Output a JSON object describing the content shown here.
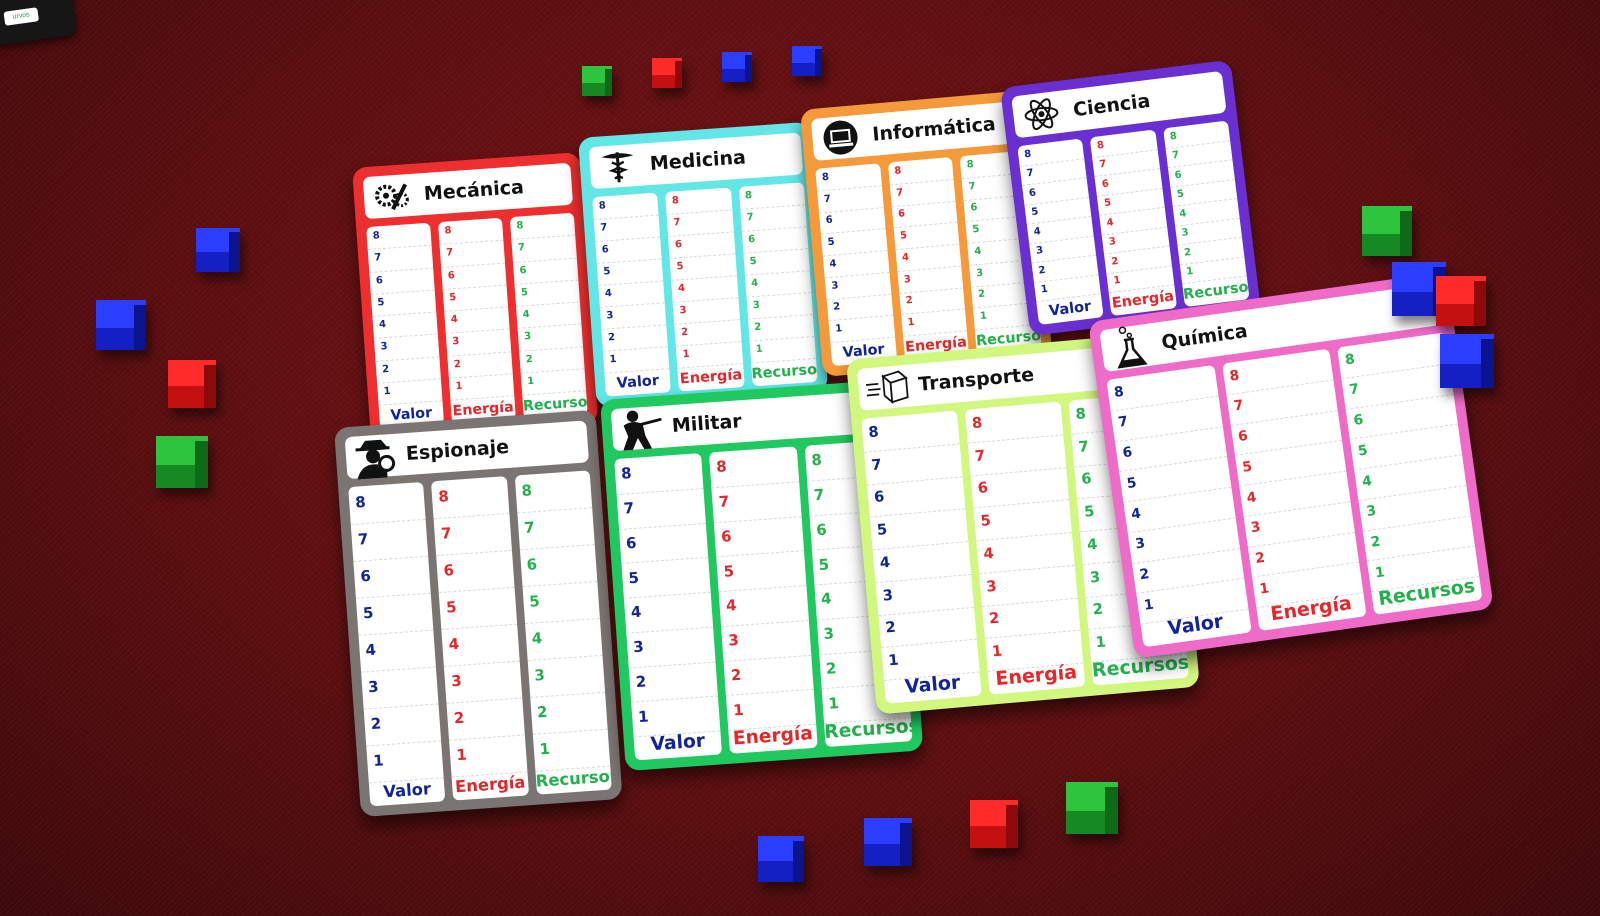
{
  "corner_tab_label": "urvos",
  "column_labels": [
    "Valor",
    "Energía",
    "Recursos"
  ],
  "values": [
    "8",
    "7",
    "6",
    "5",
    "4",
    "3",
    "2",
    "1"
  ],
  "colors": {
    "valor": "#10249a",
    "energia": "#e8262a",
    "recursos": "#22b14c",
    "felt": "#6a1214"
  },
  "cards": [
    {
      "title": "Mecánica",
      "icon": "gears-wrench-icon",
      "color": "#ee2f2f"
    },
    {
      "title": "Medicina",
      "icon": "caduceus-icon",
      "color": "#62e6e6"
    },
    {
      "title": "Informática",
      "icon": "laptop-icon",
      "color": "#f59a3a"
    },
    {
      "title": "Ciencia",
      "icon": "atom-icon",
      "color": "#6a2fd0"
    },
    {
      "title": "Espionaje",
      "icon": "spy-magnifier-icon",
      "color": "#7a7472"
    },
    {
      "title": "Militar",
      "icon": "soldier-icon",
      "color": "#20c860"
    },
    {
      "title": "Transporte",
      "icon": "package-icon",
      "color": "#d2f77e"
    },
    {
      "title": "Química",
      "icon": "flask-icon",
      "color": "#ef6bc8"
    }
  ],
  "cubes": [
    {
      "color": "green"
    },
    {
      "color": "red"
    },
    {
      "color": "blue"
    },
    {
      "color": "blue"
    },
    {
      "color": "blue"
    },
    {
      "color": "blue"
    },
    {
      "color": "red"
    },
    {
      "color": "green"
    },
    {
      "color": "green"
    },
    {
      "color": "blue"
    },
    {
      "color": "red"
    },
    {
      "color": "blue"
    },
    {
      "color": "blue"
    },
    {
      "color": "blue"
    },
    {
      "color": "red"
    },
    {
      "color": "green"
    }
  ]
}
